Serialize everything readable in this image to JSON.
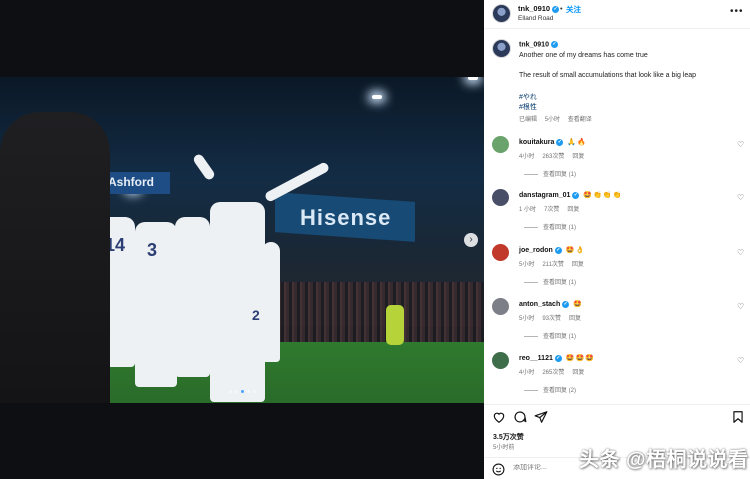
{
  "header": {
    "username": "tnk_0910",
    "follow_label": "关注",
    "separator": "•",
    "location": "Elland Road",
    "more_label": "•••"
  },
  "photo": {
    "board_text": "Hisense",
    "sign_text": "Ashford",
    "player_numbers": [
      "14",
      "3",
      "2"
    ],
    "next_icon": "chevron-right-icon",
    "slide_count": 5,
    "current_slide": 3
  },
  "caption": {
    "username": "tnk_0910",
    "line1": "Another one of my dreams has come true",
    "line2": "The result of small accumulations that look like a big leap",
    "tag1": "#やれ",
    "tag2": "#根性",
    "edited": "已编辑",
    "time": "5小时",
    "translate": "查看翻译"
  },
  "comments": [
    {
      "user": "kouitakura",
      "emoji": "🙏🔥",
      "time": "4小时",
      "likes": "263次赞",
      "reply": "回复",
      "replies": "查看回复 (1)",
      "avatar_color": "#6aa36b"
    },
    {
      "user": "danstagram_01",
      "emoji": "🤩👏👏👏",
      "time": "1 小时",
      "likes": "7次赞",
      "reply": "回复",
      "replies": "查看回复 (1)",
      "avatar_color": "#4a4f68"
    },
    {
      "user": "joe_rodon",
      "emoji": "🤩👌",
      "time": "5小时",
      "likes": "211次赞",
      "reply": "回复",
      "replies": "查看回复 (1)",
      "avatar_color": "#c0392b"
    },
    {
      "user": "anton_stach",
      "emoji": "🤩",
      "time": "5小时",
      "likes": "93次赞",
      "reply": "回复",
      "replies": "查看回复 (1)",
      "avatar_color": "#7c7f88"
    },
    {
      "user": "reo__1121",
      "emoji": "🤩🤩🤩",
      "time": "4小时",
      "likes": "265次赞",
      "reply": "回复",
      "replies": "查看回复 (2)",
      "avatar_color": "#3f6e4a"
    }
  ],
  "footer": {
    "like_count": "3.5万次赞",
    "posted_ago": "5小时前",
    "comment_placeholder": "添加评论...",
    "icons": [
      "heart-icon",
      "comment-icon",
      "share-icon",
      "bookmark-icon"
    ]
  },
  "watermark": "头条 @梧桐说说看",
  "colors": {
    "link": "#0095f6",
    "verified": "#1d9bf0",
    "hashtag": "#00376b"
  }
}
